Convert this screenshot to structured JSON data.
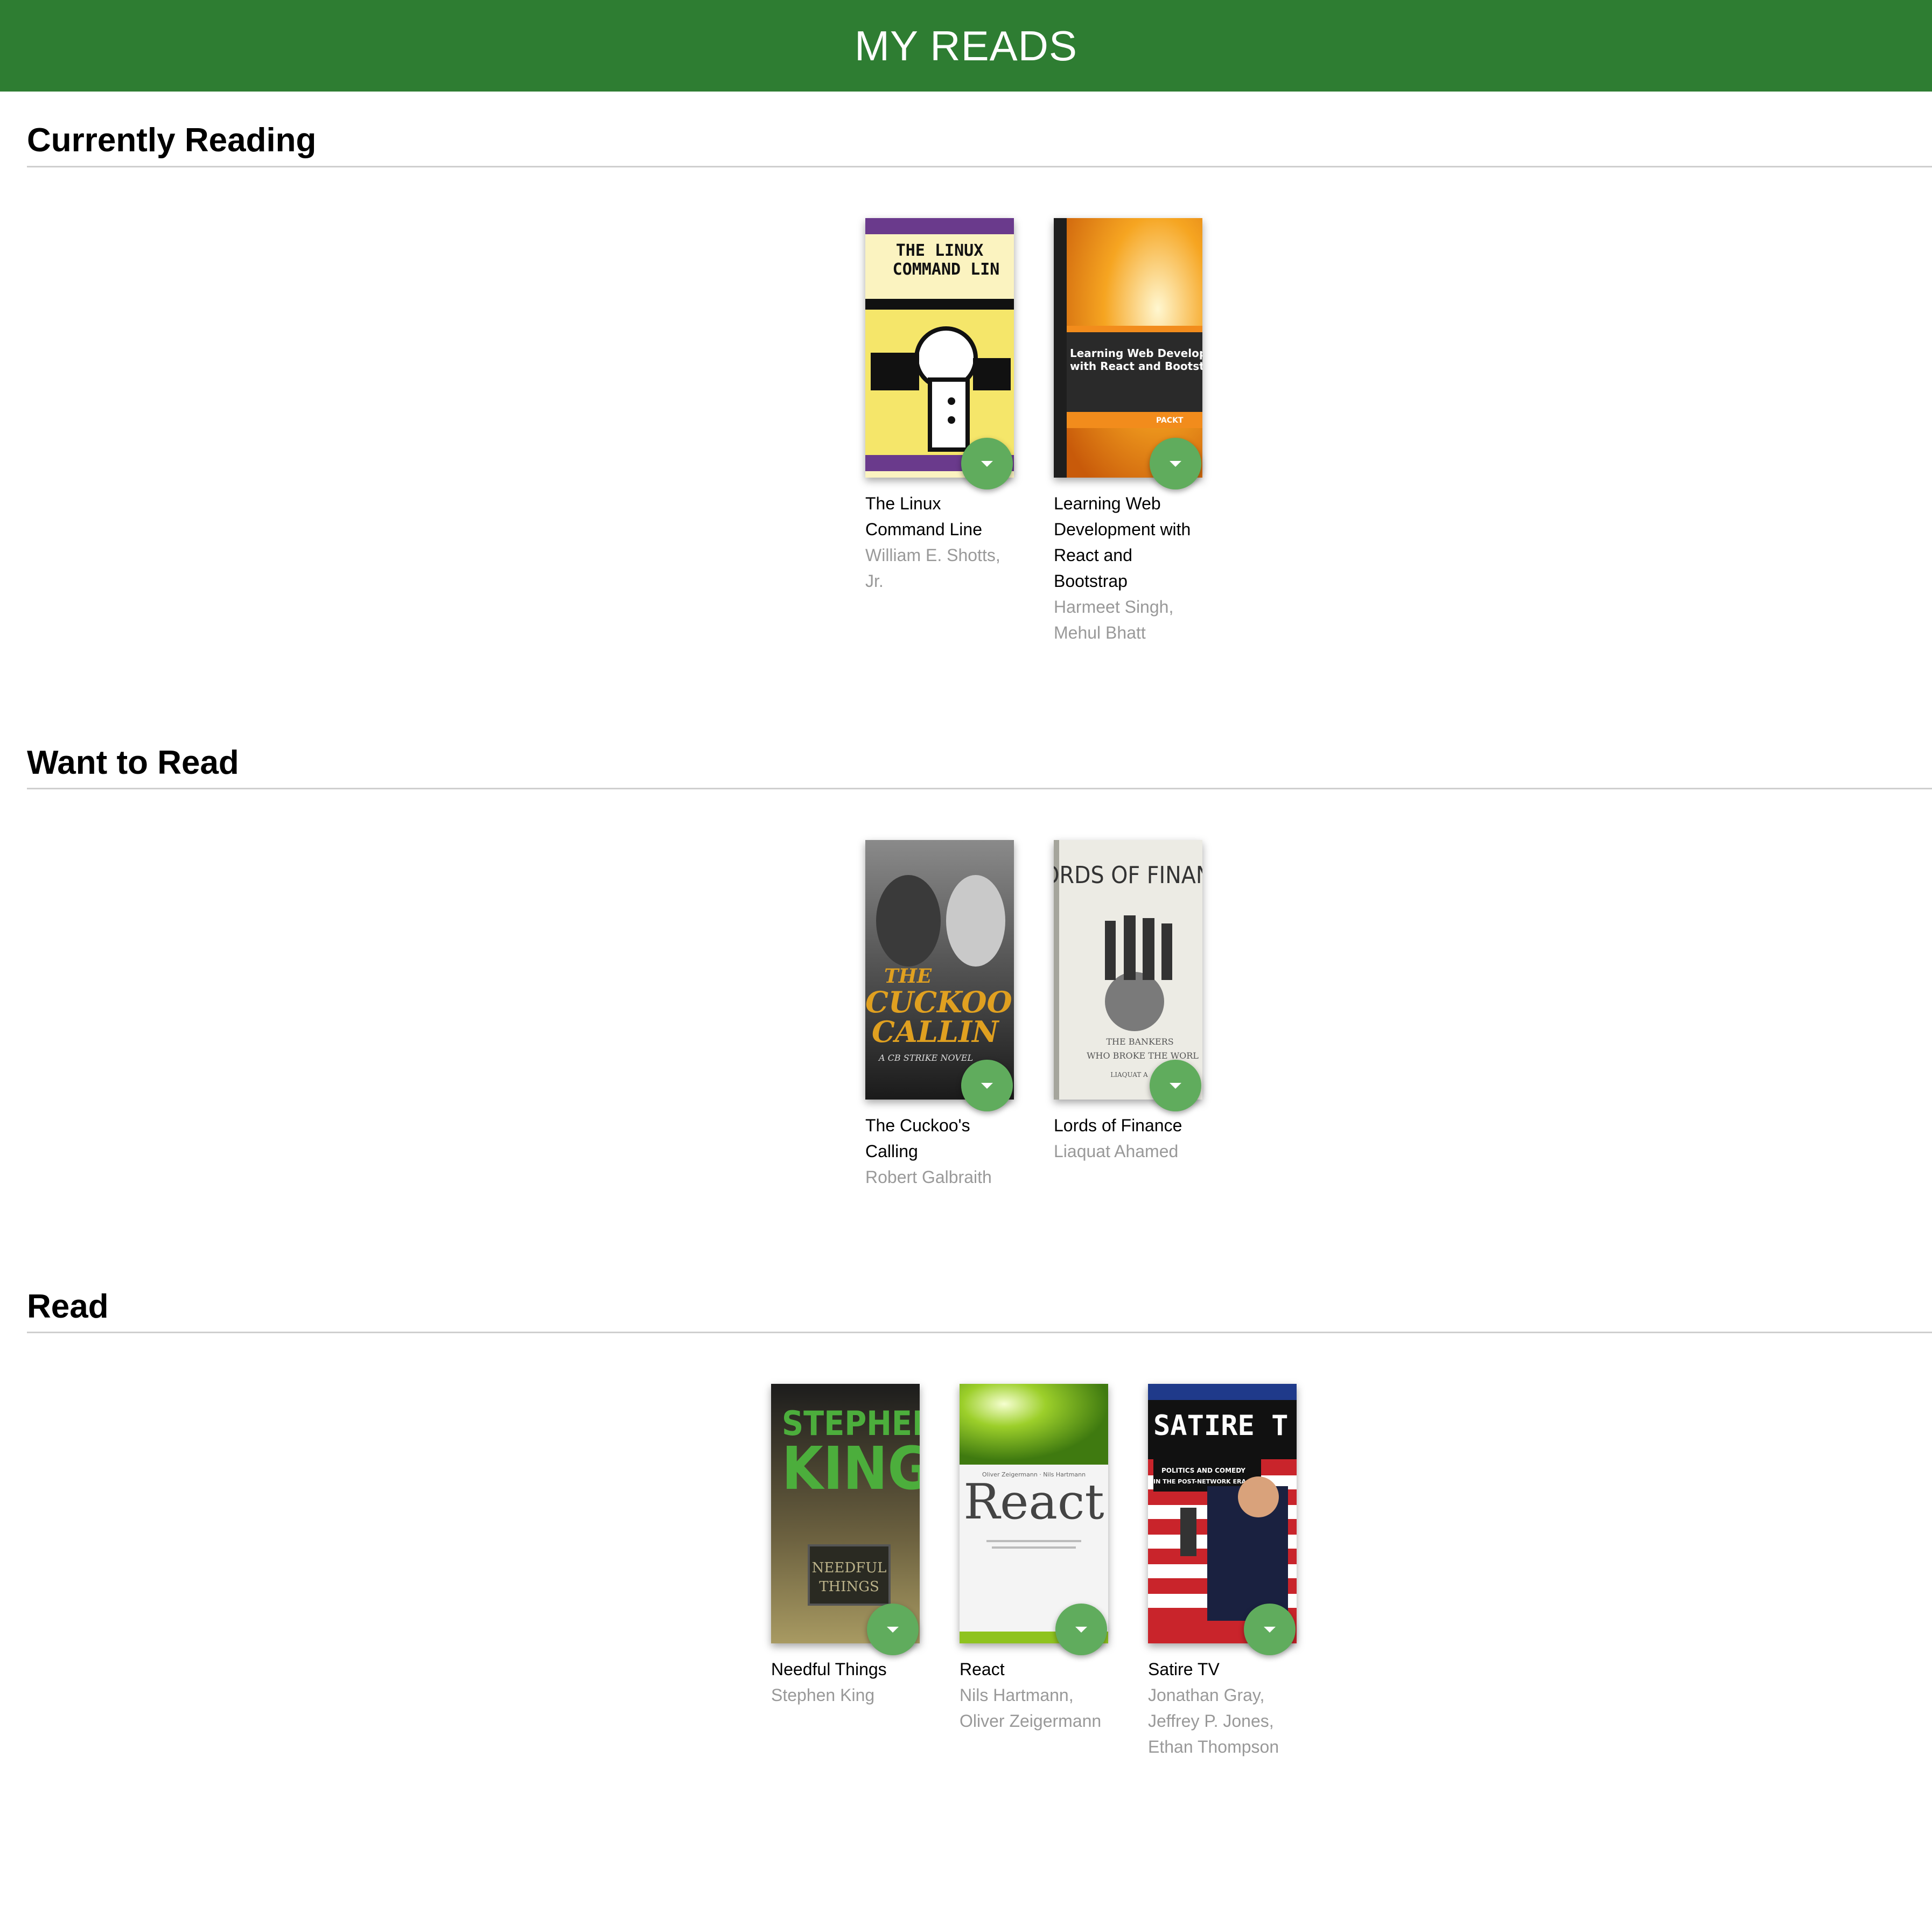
{
  "header": {
    "title": "MY READS"
  },
  "shelves": [
    {
      "title": "Currently Reading",
      "books": [
        {
          "title": "The Linux Command Line",
          "authors": "William E. Shotts, Jr.",
          "cover": {
            "line1": "THE LINUX",
            "line2": "COMMAND LIN"
          }
        },
        {
          "title": "Learning Web Development with React and Bootstrap",
          "authors": "Harmeet Singh, Mehul Bhatt",
          "cover": {
            "line1": "Learning Web Developme",
            "line2": "with React and Bootstrap",
            "publisher": "PACKT"
          }
        }
      ]
    },
    {
      "title": "Want to Read",
      "books": [
        {
          "title": "The Cuckoo's Calling",
          "authors": "Robert Galbraith",
          "cover": {
            "line1": "THE",
            "line2": "CUCKOO'",
            "line3": "CALLIN",
            "line4": "A CB STRIKE NOVEL"
          }
        },
        {
          "title": "Lords of Finance",
          "authors": "Liaquat Ahamed",
          "cover": {
            "line1": "LORDS OF FINANC",
            "line2": "THE BANKERS",
            "line3": "WHO BROKE THE WORL",
            "line4": "LIAQUAT A"
          }
        }
      ]
    },
    {
      "title": "Read",
      "books": [
        {
          "title": "Needful Things",
          "authors": "Stephen King",
          "cover": {
            "line1": "STEPHEN",
            "line2": "KING",
            "line3": "NEEDFUL",
            "line4": "THINGS"
          }
        },
        {
          "title": "React",
          "authors": "Nils Hartmann, Oliver Zeigermann",
          "cover": {
            "line1": "React",
            "line2": "Oliver Zeigermann · Nils Hartmann"
          }
        },
        {
          "title": "Satire TV",
          "authors": "Jonathan Gray, Jeffrey P. Jones, Ethan Thompson",
          "cover": {
            "line1": "SATIRE T",
            "line2": "POLITICS AND COMEDY",
            "line3": "IN THE POST-NETWORK ERA"
          }
        }
      ]
    }
  ],
  "colors": {
    "header": "#2e7d32",
    "shelf_changer": "#60ac5d",
    "author_text": "#999999"
  },
  "icons": {
    "shelf_changer": "caret-down-icon"
  }
}
